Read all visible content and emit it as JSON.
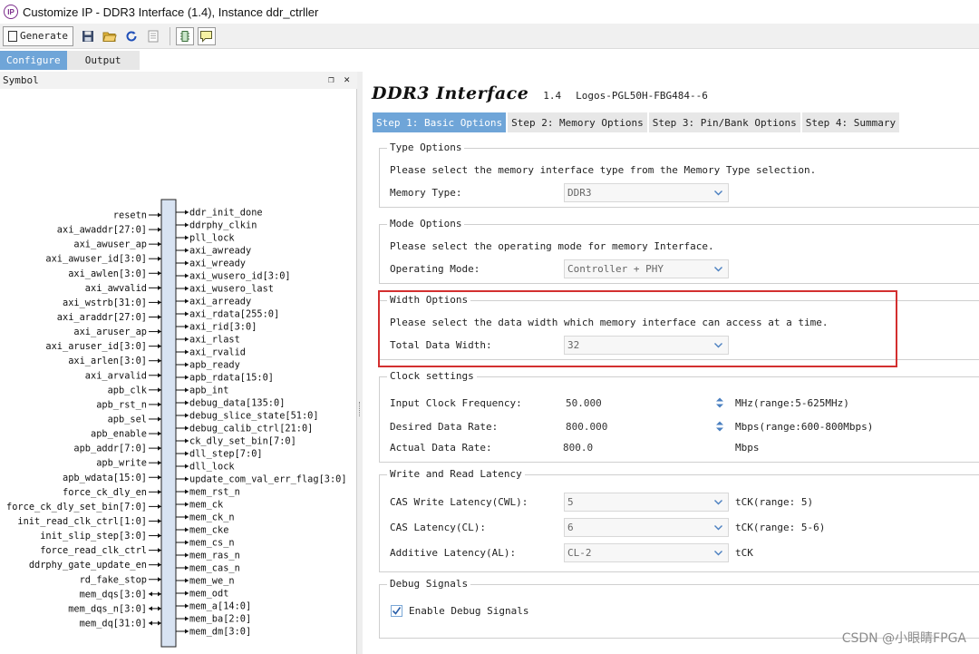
{
  "window": {
    "title": "Customize IP - DDR3 Interface (1.4), Instance ddr_ctrller",
    "logo_text": "IP"
  },
  "toolbar": {
    "generate_label": "Generate",
    "icons": [
      "generate-icon",
      "save-icon",
      "open-folder-icon",
      "refresh-icon",
      "document-icon",
      "chip-icon",
      "comment-icon"
    ]
  },
  "tabs": [
    {
      "label": "Configure",
      "active": true
    },
    {
      "label": "Output",
      "active": false
    }
  ],
  "symbol_panel": {
    "title": "Symbol",
    "controls": "❐ ✕",
    "inputs": [
      "resetn",
      "axi_awaddr[27:0]",
      "axi_awuser_ap",
      "axi_awuser_id[3:0]",
      "axi_awlen[3:0]",
      "axi_awvalid",
      "axi_wstrb[31:0]",
      "axi_araddr[27:0]",
      "axi_aruser_ap",
      "axi_aruser_id[3:0]",
      "axi_arlen[3:0]",
      "axi_arvalid",
      "apb_clk",
      "apb_rst_n",
      "apb_sel",
      "apb_enable",
      "apb_addr[7:0]",
      "apb_write",
      "apb_wdata[15:0]",
      "force_ck_dly_en",
      "force_ck_dly_set_bin[7:0]",
      "init_read_clk_ctrl[1:0]",
      "init_slip_step[3:0]",
      "force_read_clk_ctrl",
      "ddrphy_gate_update_en",
      "rd_fake_stop",
      "mem_dqs[3:0]",
      "mem_dqs_n[3:0]",
      "mem_dq[31:0]"
    ],
    "input_bidir": [
      false,
      false,
      false,
      false,
      false,
      false,
      false,
      false,
      false,
      false,
      false,
      false,
      false,
      false,
      false,
      false,
      false,
      false,
      false,
      false,
      false,
      false,
      false,
      false,
      false,
      false,
      true,
      true,
      true
    ],
    "outputs": [
      "ddr_init_done",
      "ddrphy_clkin",
      "pll_lock",
      "axi_awready",
      "axi_wready",
      "axi_wusero_id[3:0]",
      "axi_wusero_last",
      "axi_arready",
      "axi_rdata[255:0]",
      "axi_rid[3:0]",
      "axi_rlast",
      "axi_rvalid",
      "apb_ready",
      "apb_rdata[15:0]",
      "apb_int",
      "debug_data[135:0]",
      "debug_slice_state[51:0]",
      "debug_calib_ctrl[21:0]",
      "ck_dly_set_bin[7:0]",
      "dll_step[7:0]",
      "dll_lock",
      "update_com_val_err_flag[3:0]",
      "mem_rst_n",
      "mem_ck",
      "mem_ck_n",
      "mem_cke",
      "mem_cs_n",
      "mem_ras_n",
      "mem_cas_n",
      "mem_we_n",
      "mem_odt",
      "mem_a[14:0]",
      "mem_ba[2:0]",
      "mem_dm[3:0]"
    ]
  },
  "ip": {
    "name": "DDR3 Interface",
    "version": "1.4",
    "device": "Logos-PGL50H-FBG484--6"
  },
  "steps": [
    {
      "label": "Step 1: Basic Options",
      "active": true
    },
    {
      "label": "Step 2: Memory Options",
      "active": false
    },
    {
      "label": "Step 3: Pin/Bank Options",
      "active": false
    },
    {
      "label": "Step 4: Summary",
      "active": false
    }
  ],
  "type_options": {
    "title": "Type Options",
    "description": "Please select the memory interface type from the Memory Type selection.",
    "memory_type_label": "Memory Type:",
    "memory_type_value": "DDR3"
  },
  "mode_options": {
    "title": "Mode Options",
    "description": "Please select the operating mode for memory Interface.",
    "operating_mode_label": "Operating Mode:",
    "operating_mode_value": "Controller + PHY"
  },
  "width_options": {
    "title": "Width Options",
    "description": "Please select the data width which memory interface can access at a time.",
    "total_width_label": "Total Data Width:",
    "total_width_value": "32"
  },
  "clock_settings": {
    "title": "Clock settings",
    "input_freq_label": "Input Clock Frequency:",
    "input_freq_value": "50.000",
    "input_freq_unit": "MHz(range:5-625MHz)",
    "desired_rate_label": "Desired Data Rate:",
    "desired_rate_value": "800.000",
    "desired_rate_unit": "Mbps(range:600-800Mbps)",
    "actual_rate_label": "Actual Data Rate:",
    "actual_rate_value": "800.0",
    "actual_rate_unit": "Mbps"
  },
  "latency": {
    "title": "Write and Read Latency",
    "cwl_label": "CAS Write Latency(CWL):",
    "cwl_value": "5",
    "cwl_unit": "tCK(range: 5)",
    "cl_label": "CAS Latency(CL):",
    "cl_value": "6",
    "cl_unit": "tCK(range: 5-6)",
    "al_label": "Additive Latency(AL):",
    "al_value": "CL-2",
    "al_unit": "tCK"
  },
  "debug": {
    "title": "Debug Signals",
    "enable_label": "Enable Debug Signals",
    "enabled": true
  },
  "colors": {
    "accent": "#6fa5d8",
    "highlight": "#d32f2f"
  },
  "watermark": "CSDN @小眼睛FPGA"
}
